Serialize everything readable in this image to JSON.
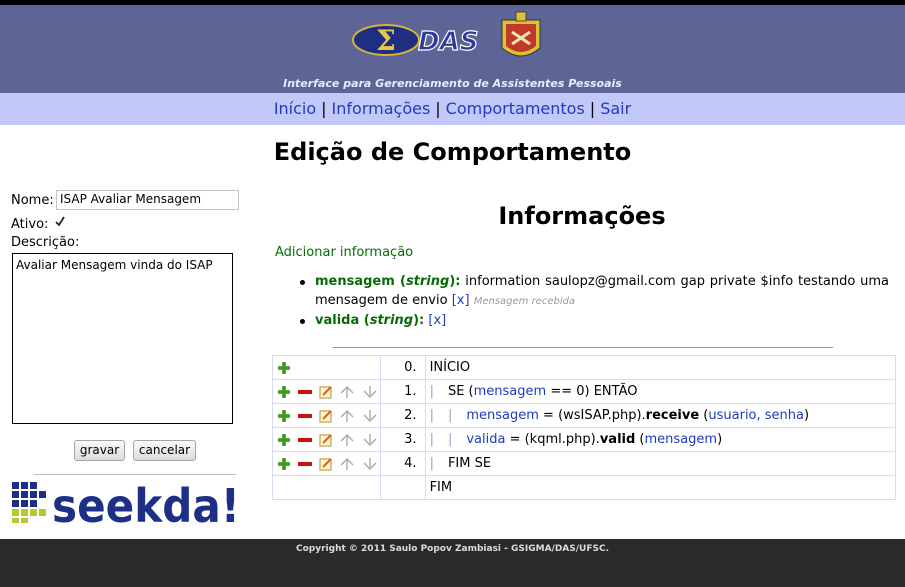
{
  "header": {
    "logo_text": "DAS",
    "subtitle": "Interface para Gerenciamento de Assistentes Pessoais"
  },
  "nav": {
    "items": [
      {
        "label": "Início"
      },
      {
        "label": "Informações"
      },
      {
        "label": "Comportamentos"
      },
      {
        "label": "Sair"
      }
    ],
    "separator": "|"
  },
  "page_title": "Edição de Comportamento",
  "form": {
    "name_label": "Nome:",
    "name_value": "ISAP Avaliar Mensagem",
    "active_label": "Ativo:",
    "active_checked": true,
    "description_label": "Descrição:",
    "description_value": "Avaliar Mensagem vinda do ISAP",
    "save_label": "gravar",
    "cancel_label": "cancelar"
  },
  "seekda_logo": "seekda!",
  "info": {
    "title": "Informações",
    "add_label": "Adicionar informação",
    "items": [
      {
        "name": "mensagem",
        "type_open": " (",
        "type": "string",
        "type_close": "):",
        "description": " information saulopz@gmail.com gap private $info testando uma mensagem de envio ",
        "delete": "[x]",
        "note": "Mensagem recebida"
      },
      {
        "name": "valida",
        "type_open": " (",
        "type": "string",
        "type_close": "):",
        "description": " ",
        "delete": "[x]",
        "note": ""
      }
    ]
  },
  "algorithm": {
    "rows": [
      {
        "num": "0.",
        "text": "INÍCIO"
      },
      {
        "num": "1.",
        "pre": "SE (",
        "var1": "mensagem",
        "post": " == 0) ENTÃO"
      },
      {
        "num": "2.",
        "var1": "mensagem",
        "mid": " = (wsISAP.php).",
        "fn": "receive",
        "args_open": " (",
        "args": "usuario, senha",
        "args_close": ")"
      },
      {
        "num": "3.",
        "var1": "valida",
        "mid": " = (kqml.php).",
        "fn": "valid",
        "args_open": " (",
        "args": "mensagem",
        "args_close": ")"
      },
      {
        "num": "4.",
        "text": "FIM SE"
      },
      {
        "num": "",
        "text": "FIM"
      }
    ]
  },
  "footer": {
    "copyright": "Copyright © 2011 Saulo Popov Zambiasi - GSIGMA/DAS/UFSC."
  },
  "colors": {
    "header_bg": "#5c6596",
    "nav_bg": "#c2c9f9",
    "link": "#1f3bbd",
    "green": "#0a6a0a",
    "red": "#cc1111",
    "footer_bg": "#2a2a2a"
  }
}
